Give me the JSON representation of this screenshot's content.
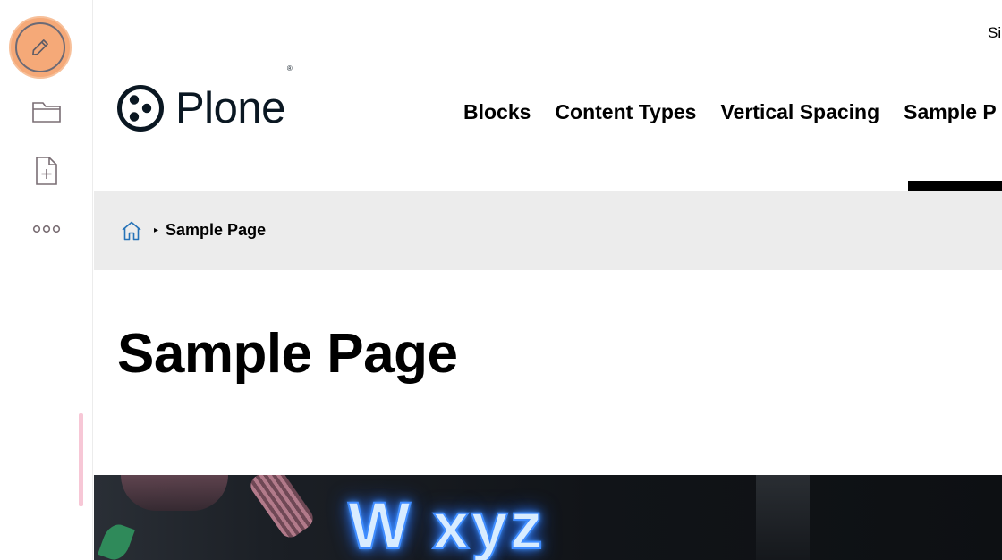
{
  "toolbar": {
    "edit_icon": "pencil-icon",
    "folder_icon": "folder-icon",
    "add_icon": "add-document-icon",
    "more_icon": "more-icon",
    "accent_color": "#f5a978"
  },
  "header": {
    "signin_label": "Si",
    "logo_text": "Plone",
    "logo_reg": "®",
    "nav": [
      {
        "label": "Blocks"
      },
      {
        "label": "Content Types"
      },
      {
        "label": "Vertical Spacing"
      },
      {
        "label": "Sample P"
      }
    ]
  },
  "breadcrumb": {
    "home_icon": "home-icon",
    "separator": "▸",
    "current": "Sample Page"
  },
  "main": {
    "title": "Sample Page",
    "hero_text": "W xyz"
  }
}
